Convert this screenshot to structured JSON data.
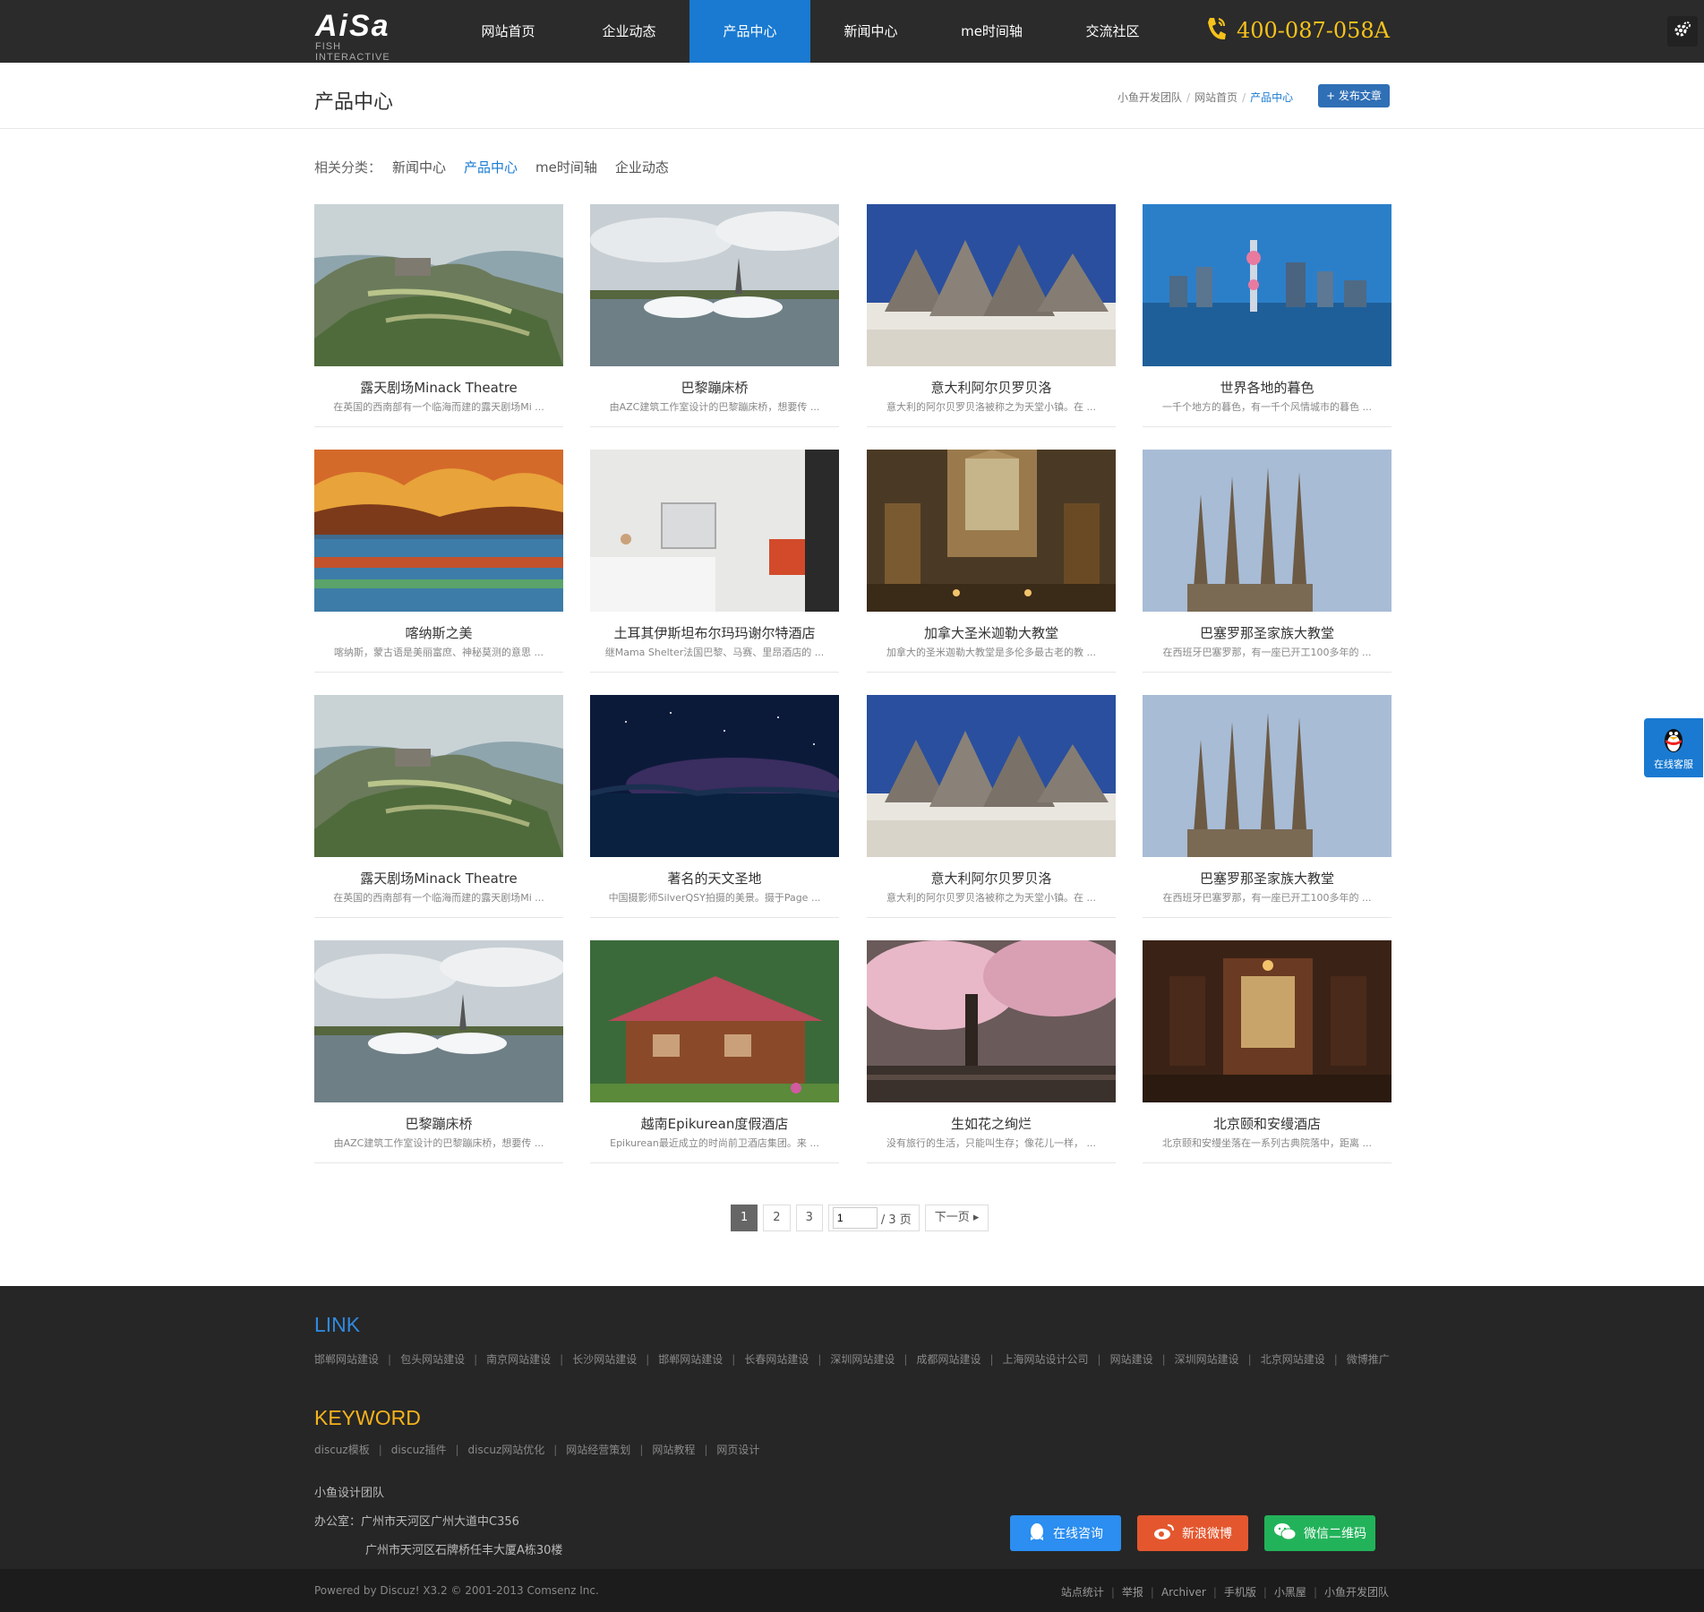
{
  "header": {
    "logo_text": "AiSa",
    "logo_sub": "FISH INTERACTIVE",
    "nav": [
      "网站首页",
      "企业动态",
      "产品中心",
      "新闻中心",
      "me时间轴",
      "交流社区"
    ],
    "active_nav": "产品中心",
    "phone": "400-087-058A",
    "accent_color": "#1a7ad1",
    "phone_color": "#f5c21b"
  },
  "page": {
    "title": "产品中心",
    "breadcrumb": [
      "小鱼开发团队",
      "网站首页",
      "产品中心"
    ],
    "post_button": "+ 发布文章"
  },
  "categories": {
    "label": "相关分类：",
    "items": [
      "新闻中心",
      "产品中心",
      "me时间轴",
      "企业动态"
    ],
    "active": "产品中心"
  },
  "products": [
    {
      "title": "露天剧场Minack Theatre",
      "desc": "在英国的西南部有一个临海而建的露天剧场Mi ...",
      "thumb": "cliff-theatre"
    },
    {
      "title": "巴黎蹦床桥",
      "desc": "由AZC建筑工作室设计的巴黎蹦床桥，想要传 ...",
      "thumb": "trampoline-bridge"
    },
    {
      "title": "意大利阿尔贝罗贝洛",
      "desc": "意大利的阿尔贝罗贝洛被称之为天堂小镇。在 ...",
      "thumb": "trulli-houses"
    },
    {
      "title": "世界各地的暮色",
      "desc": "一千个地方的暮色，有一千个风情城市的暮色 ...",
      "thumb": "city-dusk"
    },
    {
      "title": "喀纳斯之美",
      "desc": "喀纳斯，蒙古语是美丽富庶、神秘莫测的意思 ...",
      "thumb": "autumn-lake"
    },
    {
      "title": "土耳其伊斯坦布尔玛玛谢尔特酒店",
      "desc": "继Mama Shelter法国巴黎、马赛、里昂酒店的 ...",
      "thumb": "hotel-room"
    },
    {
      "title": "加拿大圣米迦勒大教堂",
      "desc": "加拿大的圣米迦勒大教堂是多伦多最古老的教 ...",
      "thumb": "cathedral-interior"
    },
    {
      "title": "巴塞罗那圣家族大教堂",
      "desc": "在西班牙巴塞罗那，有一座已开工100多年的 ...",
      "thumb": "sagrada-familia"
    },
    {
      "title": "露天剧场Minack Theatre",
      "desc": "在英国的西南部有一个临海而建的露天剧场Mi ...",
      "thumb": "cliff-theatre"
    },
    {
      "title": "著名的天文圣地",
      "desc": "中国摄影师SilverQSY拍摄的美景。摄于Page ...",
      "thumb": "starry-night"
    },
    {
      "title": "意大利阿尔贝罗贝洛",
      "desc": "意大利的阿尔贝罗贝洛被称之为天堂小镇。在 ...",
      "thumb": "trulli-houses"
    },
    {
      "title": "巴塞罗那圣家族大教堂",
      "desc": "在西班牙巴塞罗那，有一座已开工100多年的 ...",
      "thumb": "sagrada-familia"
    },
    {
      "title": "巴黎蹦床桥",
      "desc": "由AZC建筑工作室设计的巴黎蹦床桥，想要传 ...",
      "thumb": "trampoline-bridge"
    },
    {
      "title": "越南Epikurean度假酒店",
      "desc": "Epikurean最近成立的时尚前卫酒店集团。来 ...",
      "thumb": "wood-lodge"
    },
    {
      "title": "生如花之绚烂",
      "desc": "没有旅行的生活，只能叫生存；像花儿一样， ...",
      "thumb": "cherry-blossom"
    },
    {
      "title": "北京颐和安缦酒店",
      "desc": "北京颐和安缦坐落在一系列古典院落中，距离 ...",
      "thumb": "chinese-interior"
    }
  ],
  "pager": {
    "pages": [
      "1",
      "2",
      "3"
    ],
    "current": "1",
    "input_value": "1",
    "total": "/ 3 页",
    "next": "下一页 ▸"
  },
  "float_service": {
    "label": "在线客服"
  },
  "footer": {
    "link_title": "LINK",
    "links": [
      "邯郸网站建设",
      "包头网站建设",
      "南京网站建设",
      "长沙网站建设",
      "邯郸网站建设",
      "长春网站建设",
      "深圳网站建设",
      "成都网站建设",
      "上海网站设计公司",
      "网站建设",
      "深圳网站建设",
      "北京网站建设",
      "微博推广"
    ],
    "keyword_title": "KEYWORD",
    "keywords": [
      "discuz模板",
      "discuz插件",
      "discuz网站优化",
      "网站经营策划",
      "网站教程",
      "网页设计"
    ],
    "team": "小鱼设计团队",
    "office_label": "办公室：广州市天河区广州大道中C356",
    "office_line2": "广州市天河区石牌桥任丰大厦A栋30楼",
    "buttons": [
      "在线咨询",
      "新浪微博",
      "微信二维码"
    ],
    "powered": "Powered by Discuz! X3.2 © 2001-2013 Comsenz Inc.",
    "bottom_links": [
      "站点统计",
      "举报",
      "Archiver",
      "手机版",
      "小黑屋",
      "小鱼开发团队"
    ]
  }
}
